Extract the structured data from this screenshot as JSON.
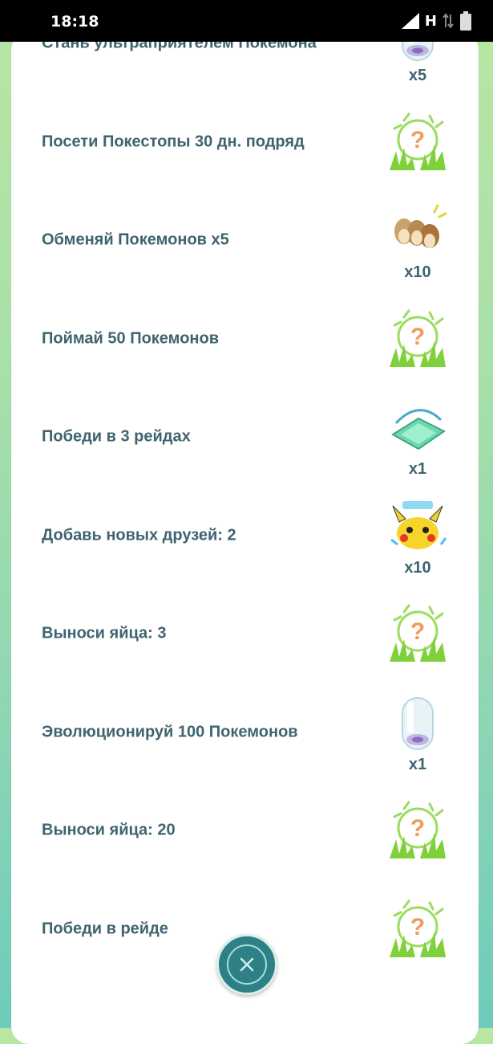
{
  "status_bar": {
    "time": "18:18",
    "network": "H"
  },
  "tasks": [
    {
      "label": "Стань ультраприятелем Покемона",
      "reward_icon": "incubator-icon",
      "count": "x5"
    },
    {
      "label": "Посети Покестопы 30 дн. подряд",
      "reward_icon": "mystery-grass-icon",
      "count": ""
    },
    {
      "label": "Обменяй Покемонов x5",
      "reward_icon": "pidgey-group-icon",
      "count": "x10"
    },
    {
      "label": "Поймай 50 Покемонов",
      "reward_icon": "mystery-grass-icon",
      "count": ""
    },
    {
      "label": "Победи в 3 рейдах",
      "reward_icon": "raid-pass-icon",
      "count": "x1"
    },
    {
      "label": "Добавь новых друзей: 2",
      "reward_icon": "pikachu-icon",
      "count": "x10"
    },
    {
      "label": "Выноси яйца: 3",
      "reward_icon": "mystery-grass-icon",
      "count": ""
    },
    {
      "label": "Эволюционируй 100 Покемонов",
      "reward_icon": "incubator-icon",
      "count": "x1"
    },
    {
      "label": "Выноси яйца: 20",
      "reward_icon": "mystery-grass-icon",
      "count": ""
    },
    {
      "label": "Победи в рейде",
      "reward_icon": "mystery-grass-icon",
      "count": ""
    }
  ],
  "colors": {
    "text": "#3f6470",
    "close_button": "#2f7f87",
    "question_mark": "#f29a5c",
    "grass": "#7fd13b"
  }
}
